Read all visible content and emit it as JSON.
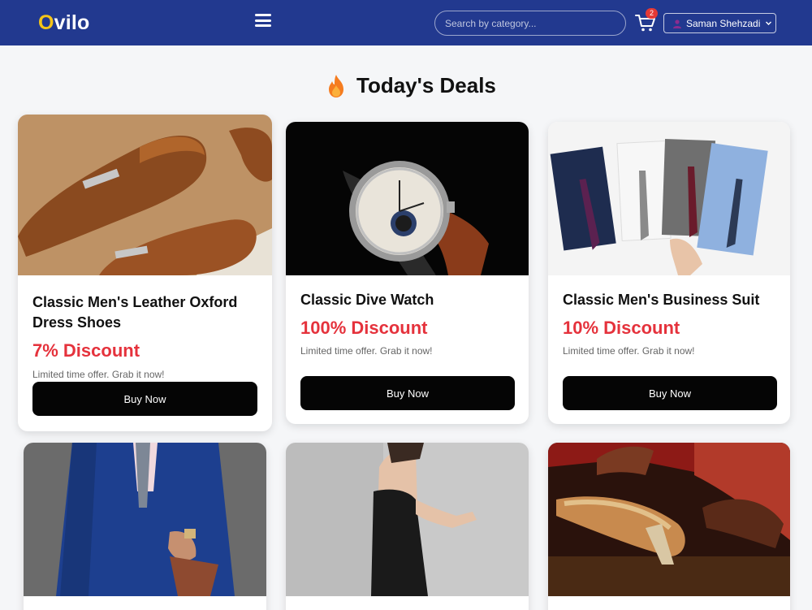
{
  "header": {
    "logo_first": "O",
    "logo_rest": "vilo",
    "search_placeholder": "Search by category...",
    "cart_count": "2",
    "user_name": "Saman Shehzadi"
  },
  "page": {
    "title": "Today's Deals"
  },
  "colors": {
    "header_bg": "#22398f",
    "logo_accent": "#f5c518",
    "discount": "#e5323c",
    "button": "#050505"
  },
  "deals": [
    {
      "name": "Classic Men's Leather Oxford Dress Shoes",
      "discount": "7% Discount",
      "note": "Limited time offer. Grab it now!",
      "button": "Buy Now",
      "image": "brown-leather-shoes"
    },
    {
      "name": "Classic Dive Watch",
      "discount": "100% Discount",
      "note": "Limited time offer. Grab it now!",
      "button": "Buy Now",
      "image": "wrist-watch"
    },
    {
      "name": "Classic Men's Business Suit",
      "discount": "10% Discount",
      "note": "Limited time offer. Grab it now!",
      "button": "Buy Now",
      "image": "dress-shirts"
    },
    {
      "image": "blue-suit"
    },
    {
      "image": "black-dress"
    },
    {
      "image": "heeled-sandals"
    }
  ]
}
